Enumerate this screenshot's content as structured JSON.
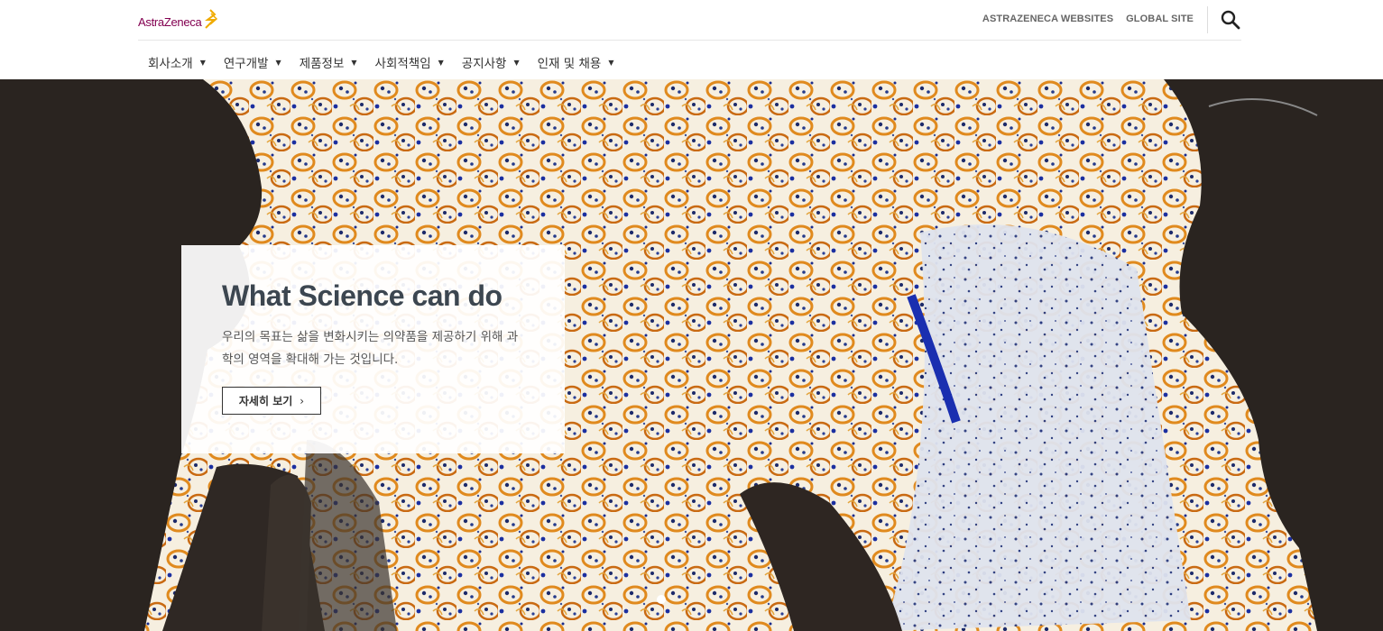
{
  "brand": {
    "logo_text": "AstraZeneca",
    "color": "#830051",
    "mark_color": "#f0ab00"
  },
  "top_links": [
    "ASTRAZENECA WEBSITES",
    "GLOBAL SITE"
  ],
  "nav": [
    {
      "label": "회사소개"
    },
    {
      "label": "연구개발"
    },
    {
      "label": "제품정보"
    },
    {
      "label": "사회적책임"
    },
    {
      "label": "공지사항"
    },
    {
      "label": "인재 및 채용"
    }
  ],
  "hero": {
    "title": "What Science can do",
    "text": "우리의 목표는 삶을 변화시키는 의약품을 제공하기 위해 과학의 영역을 확대해 가는 것입니다.",
    "button_label": "자세히 보기",
    "slides_total": 2,
    "active_slide": 1
  },
  "icons": {
    "search": "search-icon",
    "caret": "caret-down-icon",
    "chevron": "chevron-right-icon"
  }
}
